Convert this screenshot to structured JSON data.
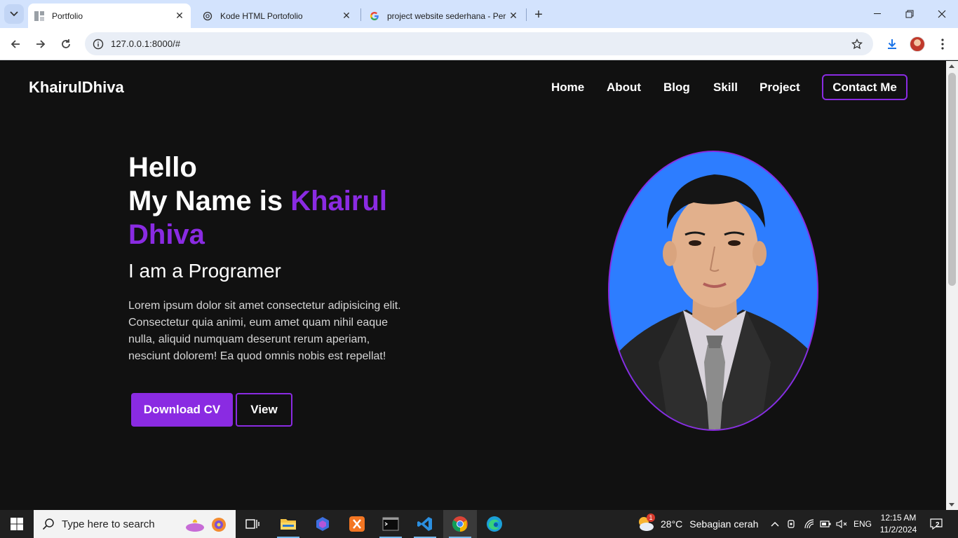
{
  "browser": {
    "tabs": [
      {
        "title": "Portfolio",
        "active": true
      },
      {
        "title": "Kode HTML Portofolio",
        "active": false
      },
      {
        "title": "project website sederhana - Per",
        "active": false
      }
    ],
    "url": "127.0.0.1:8000/#"
  },
  "site": {
    "brand": "KhairulDhiva",
    "nav": [
      "Home",
      "About",
      "Blog",
      "Skill",
      "Project"
    ],
    "contact_label": "Contact Me",
    "hero": {
      "hello": "Hello",
      "name_prefix": "My Name is ",
      "name_first": "Khairul",
      "name_last": "Dhiva",
      "role": "I am a Programer",
      "description": "Lorem ipsum dolor sit amet consectetur adipisicing elit. Consectetur quia animi, eum amet quam nihil eaque nulla, aliquid numquam deserunt rerum aperiam, nesciunt dolorem! Ea quod omnis nobis est repellat!",
      "download_label": "Download CV",
      "view_label": "View"
    },
    "colors": {
      "accent": "#8a2be2",
      "background": "#111111",
      "photo_bg": "#2d7dff"
    }
  },
  "taskbar": {
    "search_placeholder": "Type here to search",
    "weather": {
      "temp": "28°C",
      "condition": "Sebagian cerah",
      "badge": "1"
    },
    "language": "ENG",
    "time": "12:15 AM",
    "date": "11/2/2024",
    "notifications": "2"
  }
}
